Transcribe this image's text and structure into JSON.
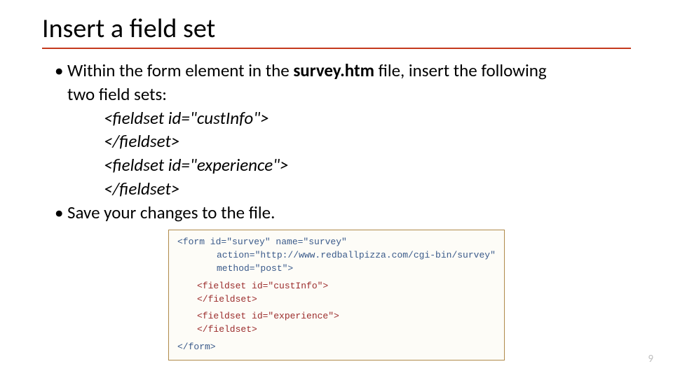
{
  "slide": {
    "title": "Insert a field set",
    "bullet1_pre": "Within the form element in the ",
    "bullet1_bold": "survey.htm",
    "bullet1_post": " file, insert the following",
    "bullet1_cont": "two field sets:",
    "code_lines": {
      "l1": "<fieldset id=\"custInfo\">",
      "l2": "</fieldset>",
      "l3": "<fieldset id=\"experience\">",
      "l4": "</fieldset>"
    },
    "bullet2": "Save your changes to the file.",
    "codebox": {
      "b1": "<form id=\"survey\" name=\"survey\"",
      "b2": "action=\"http://www.redballpizza.com/cgi-bin/survey\"",
      "b3": "method=\"post\">",
      "r1": "<fieldset id=\"custInfo\">",
      "r2": "</fieldset>",
      "r3": "<fieldset id=\"experience\">",
      "r4": "</fieldset>",
      "b4": "</form>"
    },
    "page_number": "9"
  }
}
